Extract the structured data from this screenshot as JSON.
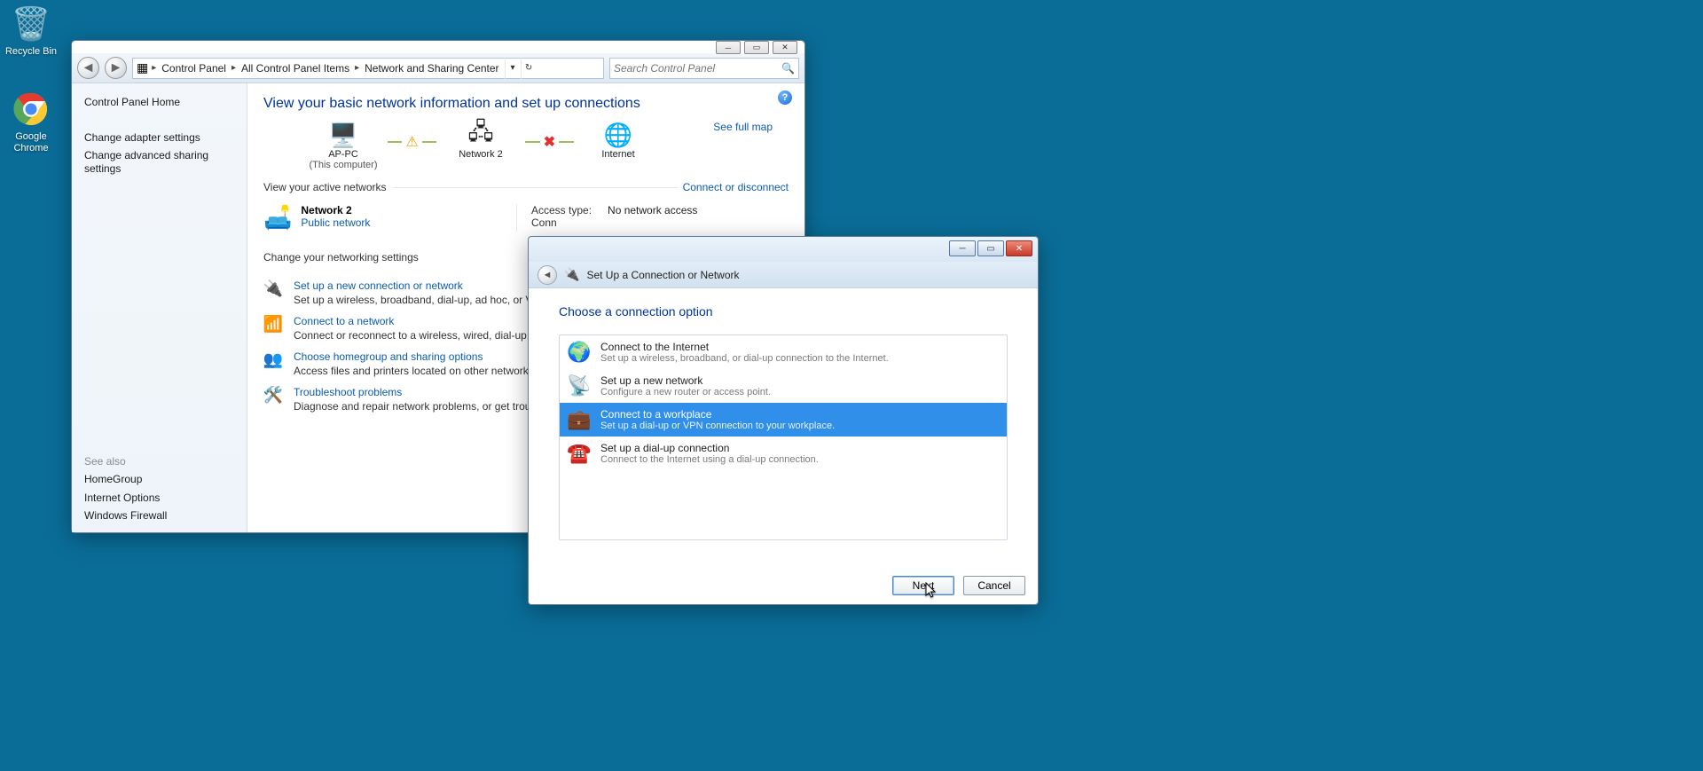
{
  "desktop": {
    "recycle": "Recycle Bin",
    "chrome": "Google Chrome"
  },
  "cp": {
    "breadcrumb": {
      "a": "Control Panel",
      "b": "All Control Panel Items",
      "c": "Network and Sharing Center"
    },
    "search_placeholder": "Search Control Panel",
    "sidebar": {
      "home": "Control Panel Home",
      "t1": "Change adapter settings",
      "t2": "Change advanced sharing settings",
      "seealso": "See also",
      "s1": "HomeGroup",
      "s2": "Internet Options",
      "s3": "Windows Firewall"
    },
    "heading": "View your basic network information and set up connections",
    "seefull": "See full map",
    "nodes": {
      "pc": "AP-PC",
      "pc_sub": "(This computer)",
      "net": "Network  2",
      "inet": "Internet"
    },
    "row_active_label": "View your active networks",
    "connect_link": "Connect or disconnect",
    "active": {
      "name": "Network  2",
      "type": "Public network",
      "access_k": "Access type:",
      "access_v": "No network access",
      "conn_k": "Conn"
    },
    "change_hdr": "Change your networking settings",
    "items": [
      {
        "t": "Set up a new connection or network",
        "d": "Set up a wireless, broadband, dial-up, ad hoc, or VPN"
      },
      {
        "t": "Connect to a network",
        "d": "Connect or reconnect to a wireless, wired, dial-up, or"
      },
      {
        "t": "Choose homegroup and sharing options",
        "d": "Access files and printers located on other network co"
      },
      {
        "t": "Troubleshoot problems",
        "d": "Diagnose and repair network problems, or get trouble"
      }
    ]
  },
  "wiz": {
    "title": "Set Up a Connection or Network",
    "heading": "Choose a connection option",
    "options": [
      {
        "t": "Connect to the Internet",
        "d": "Set up a wireless, broadband, or dial-up connection to the Internet."
      },
      {
        "t": "Set up a new network",
        "d": "Configure a new router or access point."
      },
      {
        "t": "Connect to a workplace",
        "d": "Set up a dial-up or VPN connection to your workplace."
      },
      {
        "t": "Set up a dial-up connection",
        "d": "Connect to the Internet using a dial-up connection."
      }
    ],
    "selected_index": 2,
    "next": "Next",
    "cancel": "Cancel"
  }
}
